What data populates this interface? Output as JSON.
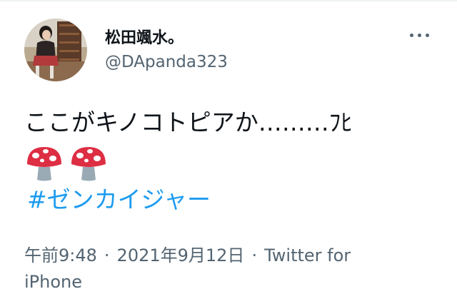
{
  "user": {
    "display_name": "松田颯水。",
    "handle": "@DApanda323"
  },
  "tweet": {
    "text": "ここがキノコトピアか………ﾌﾋ",
    "emojis": [
      "mushroom-emoji",
      "mushroom-emoji"
    ],
    "hashtag": "#ゼンカイジャー"
  },
  "meta": {
    "time": "午前9:48",
    "separator_1": "·",
    "date": "2021年9月12日",
    "separator_2": "·",
    "source": "Twitter for iPhone"
  },
  "icons": {
    "more": "more-options-icon"
  },
  "colors": {
    "text": "#0f1419",
    "secondary": "#536471",
    "link": "#1d9bf0",
    "mushroom_cap": "#dd2e44",
    "mushroom_stem": "#99aab5"
  }
}
